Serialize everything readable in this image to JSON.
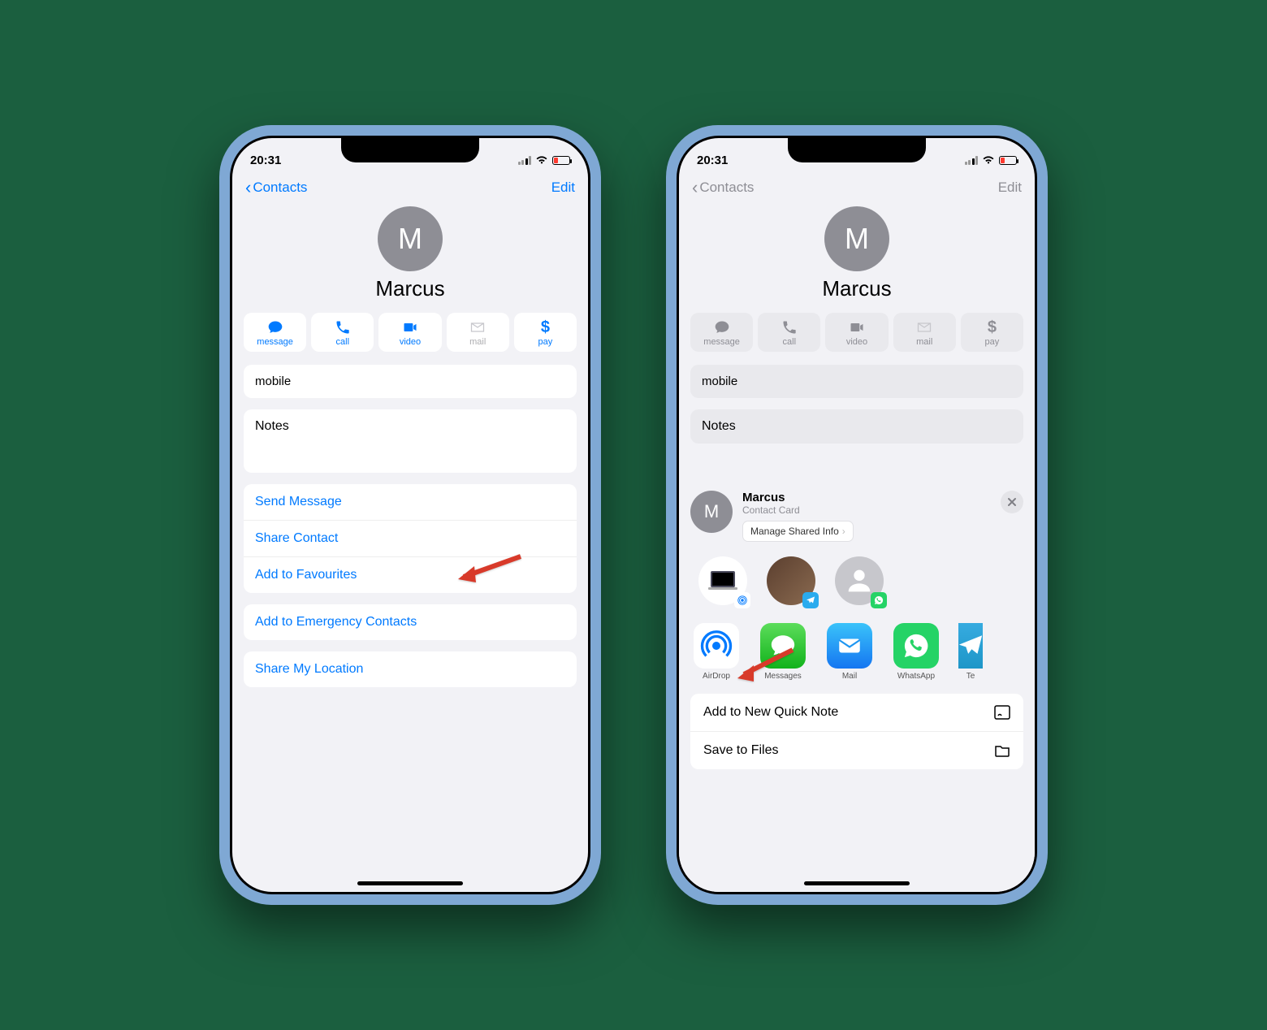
{
  "status": {
    "time": "20:31"
  },
  "nav": {
    "back": "Contacts",
    "edit": "Edit"
  },
  "contact": {
    "initial": "M",
    "name": "Marcus"
  },
  "actions": [
    {
      "label": "message",
      "enabled": true
    },
    {
      "label": "call",
      "enabled": true
    },
    {
      "label": "video",
      "enabled": true
    },
    {
      "label": "mail",
      "enabled": false
    },
    {
      "label": "pay",
      "enabled": true
    }
  ],
  "fields": {
    "phone_label": "mobile",
    "notes": "Notes"
  },
  "links_group1": [
    "Send Message",
    "Share Contact",
    "Add to Favourites"
  ],
  "links_group2": [
    "Add to Emergency Contacts"
  ],
  "links_group3": [
    "Share My Location"
  ],
  "sheet": {
    "title": "Marcus",
    "subtitle": "Contact Card",
    "manage": "Manage Shared Info",
    "apps": [
      "AirDrop",
      "Messages",
      "Mail",
      "WhatsApp",
      "Te"
    ],
    "actions": [
      "Add to New Quick Note",
      "Save to Files"
    ]
  }
}
